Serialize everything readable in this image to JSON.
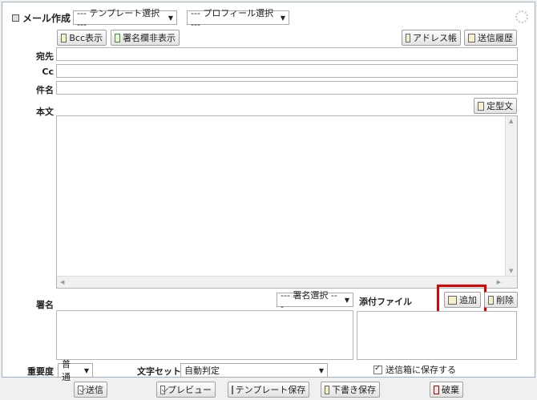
{
  "title": "メール作成",
  "template_select": "--- テンプレート選択 ---",
  "profile_select": "--- プロフィール選択 ---",
  "toolbar": {
    "bcc": "Bcc表示",
    "signature_toggle": "署名欄非表示",
    "address_book": "アドレス帳",
    "send_history": "送信履歴"
  },
  "fields": {
    "to_label": "宛先",
    "cc_label": "Cc",
    "subject_label": "件名",
    "body_label": "本文",
    "fixed_phrase": "定型文"
  },
  "signature": {
    "label": "署名",
    "select": "--- 署名選択 ---"
  },
  "attachments": {
    "label": "添付ファイル",
    "add": "追加",
    "delete": "削除"
  },
  "options": {
    "importance_label": "重要度",
    "importance_value": "普通",
    "charset_label": "文字セット",
    "charset_value": "自動判定",
    "save_to_sent_label": "送信箱に保存する",
    "save_to_sent_checked": true
  },
  "footer": {
    "send": "送信",
    "preview": "プレビュー",
    "template_save": "テンプレート保存",
    "draft_save": "下書き保存",
    "discard": "破棄"
  }
}
